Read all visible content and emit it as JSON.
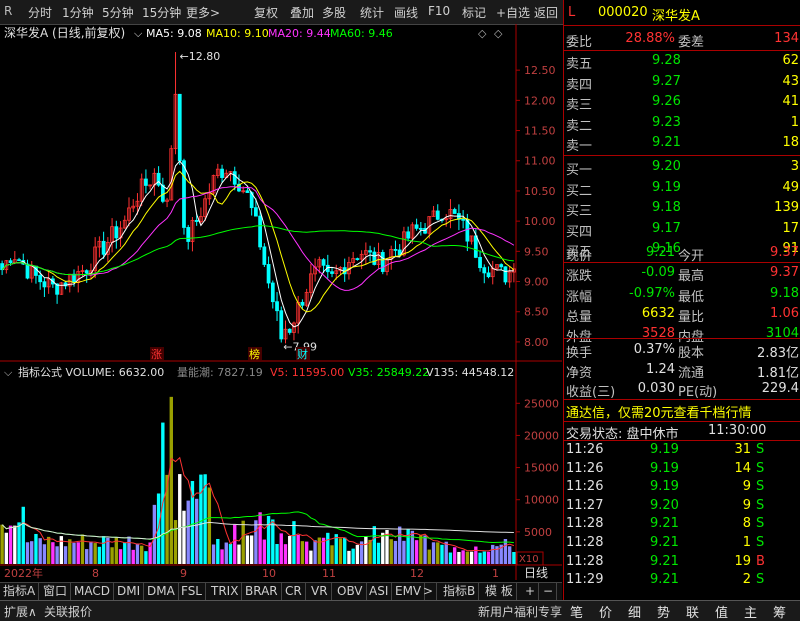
{
  "toolbar": {
    "logo": "R",
    "items": [
      "分时",
      "1分钟",
      "5分钟",
      "15分钟",
      "更多>",
      "复权",
      "叠加",
      "多股",
      "统计",
      "画线",
      "F10",
      "标记",
      "+自选",
      "返回"
    ]
  },
  "chart": {
    "title": "深华发A (日线,前复权)",
    "ma": [
      {
        "label": "MA5: 9.08",
        "color": "#ffffff"
      },
      {
        "label": "MA10: 9.10",
        "color": "#ffff00"
      },
      {
        "label": "MA20: 9.44",
        "color": "#ff33ff"
      },
      {
        "label": "MA60: 9.46",
        "color": "#00ff00"
      }
    ],
    "high_marker": "12.80",
    "low_marker": "7.99",
    "price_ticks": [
      "12.50",
      "12.00",
      "11.50",
      "11.00",
      "10.50",
      "10.00",
      "9.50",
      "9.00",
      "8.50",
      "8.00"
    ],
    "badges": [
      "涨",
      "榜",
      "财"
    ],
    "volume_header": "指标公式 VOLUME: 6632.00",
    "volume_extra": [
      {
        "label": "量能潮: 7827.19",
        "color": "#888888"
      },
      {
        "label": "V5: 11595.00",
        "color": "#ff3232"
      },
      {
        "label": "V35: 25849.22",
        "color": "#00ff00"
      },
      {
        "label": "V135: 44548.12",
        "color": "#e0e0e0"
      }
    ],
    "volume_ticks": [
      "25000",
      "20000",
      "15000",
      "10000",
      "5000"
    ],
    "x10": "X10",
    "date_labels": [
      "2022年",
      "8",
      "9",
      "10",
      "11",
      "12",
      "1"
    ],
    "period": "日线"
  },
  "chart_data": {
    "type": "candlestick+volume",
    "price_range": [
      7.8,
      12.9
    ],
    "volume_range": [
      0,
      28000
    ],
    "marked_high": 12.8,
    "marked_low": 7.99,
    "latest_close": 9.21,
    "ma_values": {
      "MA5": 9.08,
      "MA10": 9.1,
      "MA20": 9.44,
      "MA60": 9.46
    },
    "latest_volume": 6632
  },
  "tabs": [
    "指标A",
    "窗口",
    "MACD",
    "DMI",
    "DMA",
    "FSL",
    "TRIX",
    "BRAR",
    "CR",
    "VR",
    "OBV",
    "ASI",
    "EMV",
    ">",
    "指标B",
    "模 板",
    "+",
    "−"
  ],
  "panel": {
    "flag": "L",
    "code": "000020",
    "name": "深华发A",
    "weibi_label": "委比",
    "weibi": "28.88%",
    "weicha_label": "委差",
    "weicha": "134",
    "asks": [
      {
        "label": "卖五",
        "price": "9.28",
        "vol": "62"
      },
      {
        "label": "卖四",
        "price": "9.27",
        "vol": "43"
      },
      {
        "label": "卖三",
        "price": "9.26",
        "vol": "41"
      },
      {
        "label": "卖二",
        "price": "9.23",
        "vol": "1"
      },
      {
        "label": "卖一",
        "price": "9.21",
        "vol": "18"
      }
    ],
    "bids": [
      {
        "label": "买一",
        "price": "9.20",
        "vol": "3"
      },
      {
        "label": "买二",
        "price": "9.19",
        "vol": "49"
      },
      {
        "label": "买三",
        "price": "9.18",
        "vol": "139"
      },
      {
        "label": "买四",
        "price": "9.17",
        "vol": "17"
      },
      {
        "label": "买五",
        "price": "9.16",
        "vol": "91"
      }
    ],
    "stats": [
      {
        "l1": "现价",
        "v1": "9.21",
        "c1": "grn",
        "l2": "今开",
        "v2": "9.37",
        "c2": "red"
      },
      {
        "l1": "涨跌",
        "v1": "-0.09",
        "c1": "grn",
        "l2": "最高",
        "v2": "9.37",
        "c2": "red"
      },
      {
        "l1": "涨幅",
        "v1": "-0.97%",
        "c1": "grn",
        "l2": "最低",
        "v2": "9.18",
        "c2": "grn"
      },
      {
        "l1": "总量",
        "v1": "6632",
        "c1": "yel",
        "l2": "量比",
        "v2": "1.06",
        "c2": "red"
      },
      {
        "l1": "外盘",
        "v1": "3528",
        "c1": "red",
        "l2": "内盘",
        "v2": "3104",
        "c2": "grn"
      }
    ],
    "stats2": [
      {
        "l1": "换手",
        "v1": "0.37%",
        "l2": "股本",
        "v2": "2.83亿"
      },
      {
        "l1": "净资",
        "v1": "1.24",
        "l2": "流通",
        "v2": "1.81亿"
      },
      {
        "l1": "收益(三)",
        "v1": "0.030",
        "l2": "PE(动)",
        "v2": "229.4"
      }
    ],
    "promo": "通达信，仅需20元查看千档行情",
    "trade_status_label": "交易状态: 盘中休市",
    "trade_status_time": "11:30:00",
    "ticks": [
      {
        "t": "11:26",
        "p": "9.19",
        "v": "31",
        "s": "S"
      },
      {
        "t": "11:26",
        "p": "9.19",
        "v": "14",
        "s": "S"
      },
      {
        "t": "11:26",
        "p": "9.19",
        "v": "9",
        "s": "S"
      },
      {
        "t": "11:27",
        "p": "9.20",
        "v": "9",
        "s": "S"
      },
      {
        "t": "11:28",
        "p": "9.21",
        "v": "8",
        "s": "S"
      },
      {
        "t": "11:28",
        "p": "9.21",
        "v": "1",
        "s": "S"
      },
      {
        "t": "11:28",
        "p": "9.21",
        "v": "19",
        "s": "B"
      },
      {
        "t": "11:29",
        "p": "9.21",
        "v": "2",
        "s": "S"
      }
    ]
  },
  "statusbar": {
    "left": [
      "扩展∧",
      "关联报价"
    ],
    "promo": "新用户福利专享",
    "icons": [
      "笔",
      "价",
      "细",
      "势",
      "联",
      "值",
      "主",
      "筹"
    ]
  }
}
